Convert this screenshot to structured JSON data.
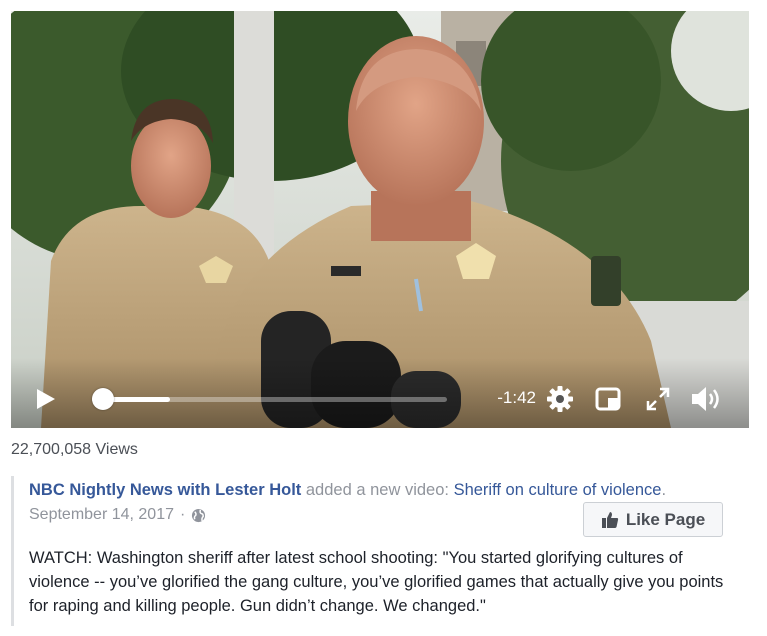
{
  "video": {
    "time_remaining": "-1:42",
    "progress_fraction": 0.03,
    "buffered_fraction": 0.22,
    "controls": {
      "play": "play-icon",
      "settings": "gear-icon",
      "picture_in_picture": "pip-icon",
      "fullscreen": "expand-icon",
      "volume": "speaker-icon"
    }
  },
  "views": "22,700,058 Views",
  "post": {
    "page_name": "NBC Nightly News with Lester Holt",
    "action_text": " added a new video: ",
    "video_title": "Sheriff on culture of violence",
    "title_suffix": ".",
    "date": "September 14, 2017",
    "separator": "·",
    "privacy_icon": "globe-icon",
    "caption": "WATCH: Washington sheriff after latest school shooting: \"You started glorifying cultures of violence -- you’ve glorified the gang culture, you’ve glorified games that actually give you points for raping and killing people. Gun didn’t change. We changed.\""
  },
  "like_page": {
    "label": "Like Page",
    "icon": "thumbs-up-icon"
  },
  "colors": {
    "link": "#365899",
    "meta": "#90949c",
    "text": "#1d2129"
  }
}
